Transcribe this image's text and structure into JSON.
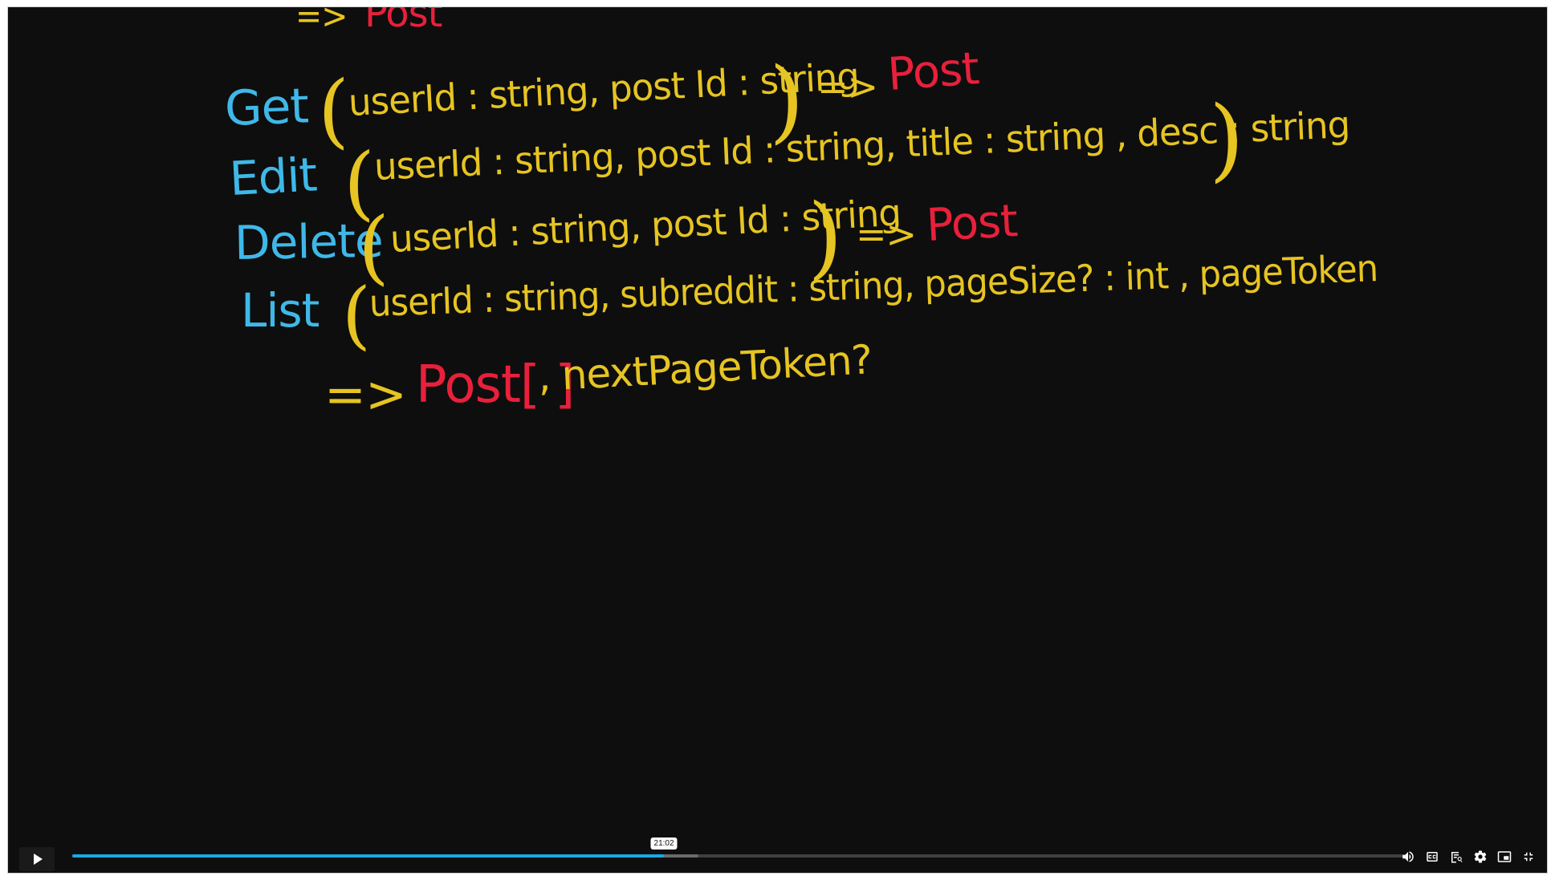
{
  "board": {
    "top_line": {
      "arrow": "=>",
      "ret": "Post"
    },
    "get": {
      "method": "Get",
      "params": "userId : string, post Id : string",
      "arrow": "=>",
      "ret": "Post"
    },
    "edit": {
      "method": "Edit",
      "params": "userId : string, post Id : string, title : string , desc : string"
    },
    "delete": {
      "method": "Delete",
      "params": "userId : string, post Id : string",
      "arrow": "=>",
      "ret": "Post"
    },
    "list": {
      "method": "List",
      "params": "userId : string, subreddit : string, pageSize? : int , pageToken"
    },
    "list_return": {
      "arrow": "=>",
      "ret": "Post[ ]",
      "rest": ", nextPageToken?"
    }
  },
  "player": {
    "time_tooltip": "21:02",
    "progress_fraction": 0.444,
    "buffered_fraction": 0.47,
    "icons": [
      "play-icon",
      "volume-icon",
      "captions-icon",
      "transcript-icon",
      "settings-icon",
      "miniplayer-icon",
      "fullscreen-exit-icon"
    ],
    "accent": "#18a8e6"
  }
}
